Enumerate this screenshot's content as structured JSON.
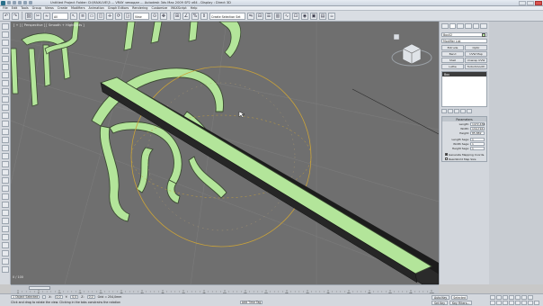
{
  "window": {
    "title": "Untitled      Project Folder: D:\\MAXLIVE\\3 ... VRAY  чемодан ... Autodesk 3ds Max 2009 SP2 x64  -  Display : Direct 3D"
  },
  "menu": [
    "File",
    "Edit",
    "Tools",
    "Group",
    "Views",
    "Create",
    "Modifiers",
    "Animation",
    "Graph Editors",
    "Rendering",
    "Customize",
    "MAXScript",
    "Help"
  ],
  "toolbar": {
    "selection_filter": "All",
    "named_selection": "Create Selection Set",
    "coord_system": "View"
  },
  "viewport": {
    "label": "[ + ] [ Perspective ] [ Smooth + Highlights ]",
    "frame_counter": "0 / 100"
  },
  "command_panel": {
    "object_name": "Box02",
    "modifier_list_label": "Modifier List",
    "modifier_buttons": [
      "Extrude",
      "Optic",
      "Bend",
      "UVW Map",
      "Shell",
      "Unwrap UVW",
      "Lathe",
      "TurboSmooth"
    ],
    "stack_item": "Box",
    "parameters": {
      "header": "Parameters",
      "length_label": "Length:",
      "length_value": "1472,436",
      "width_label": "Width:",
      "width_value": "134,716",
      "height_label": "Height:",
      "height_value": "85,882",
      "length_segs_label": "Length Segs:",
      "length_segs_value": "1",
      "width_segs_label": "Width Segs:",
      "width_segs_value": "1",
      "height_segs_label": "Height Segs:",
      "height_segs_value": "1",
      "gen_mapping_label": "Generate Mapping Coords.",
      "real_world_label": "Real-World Map Size"
    }
  },
  "status": {
    "selection_text": "1 Object Selected",
    "prompt_text": "Click and drag to rotate the view.  Clicking in the tabs constrains the rotation",
    "x_label": "X:",
    "x_value": "0,0",
    "y_label": "Y:",
    "y_value": "0,0",
    "z_label": "Z:",
    "z_value": "0,0",
    "grid_text": "Grid = 254,0mm",
    "add_time_tag": "Add Time Tag",
    "auto_key": "Auto Key",
    "selected_option": "Selected",
    "set_key": "Set Key",
    "key_filters": "Key Filters..."
  },
  "timeline_ticks": [
    "0",
    "5",
    "10",
    "15",
    "20",
    "25",
    "30",
    "35",
    "40",
    "45",
    "50",
    "55",
    "60",
    "65",
    "70",
    "75",
    "80",
    "85",
    "90",
    "95",
    "100"
  ],
  "colors": {
    "object_green": "#b3e59a",
    "viewport_bg": "#6f6f6f"
  }
}
